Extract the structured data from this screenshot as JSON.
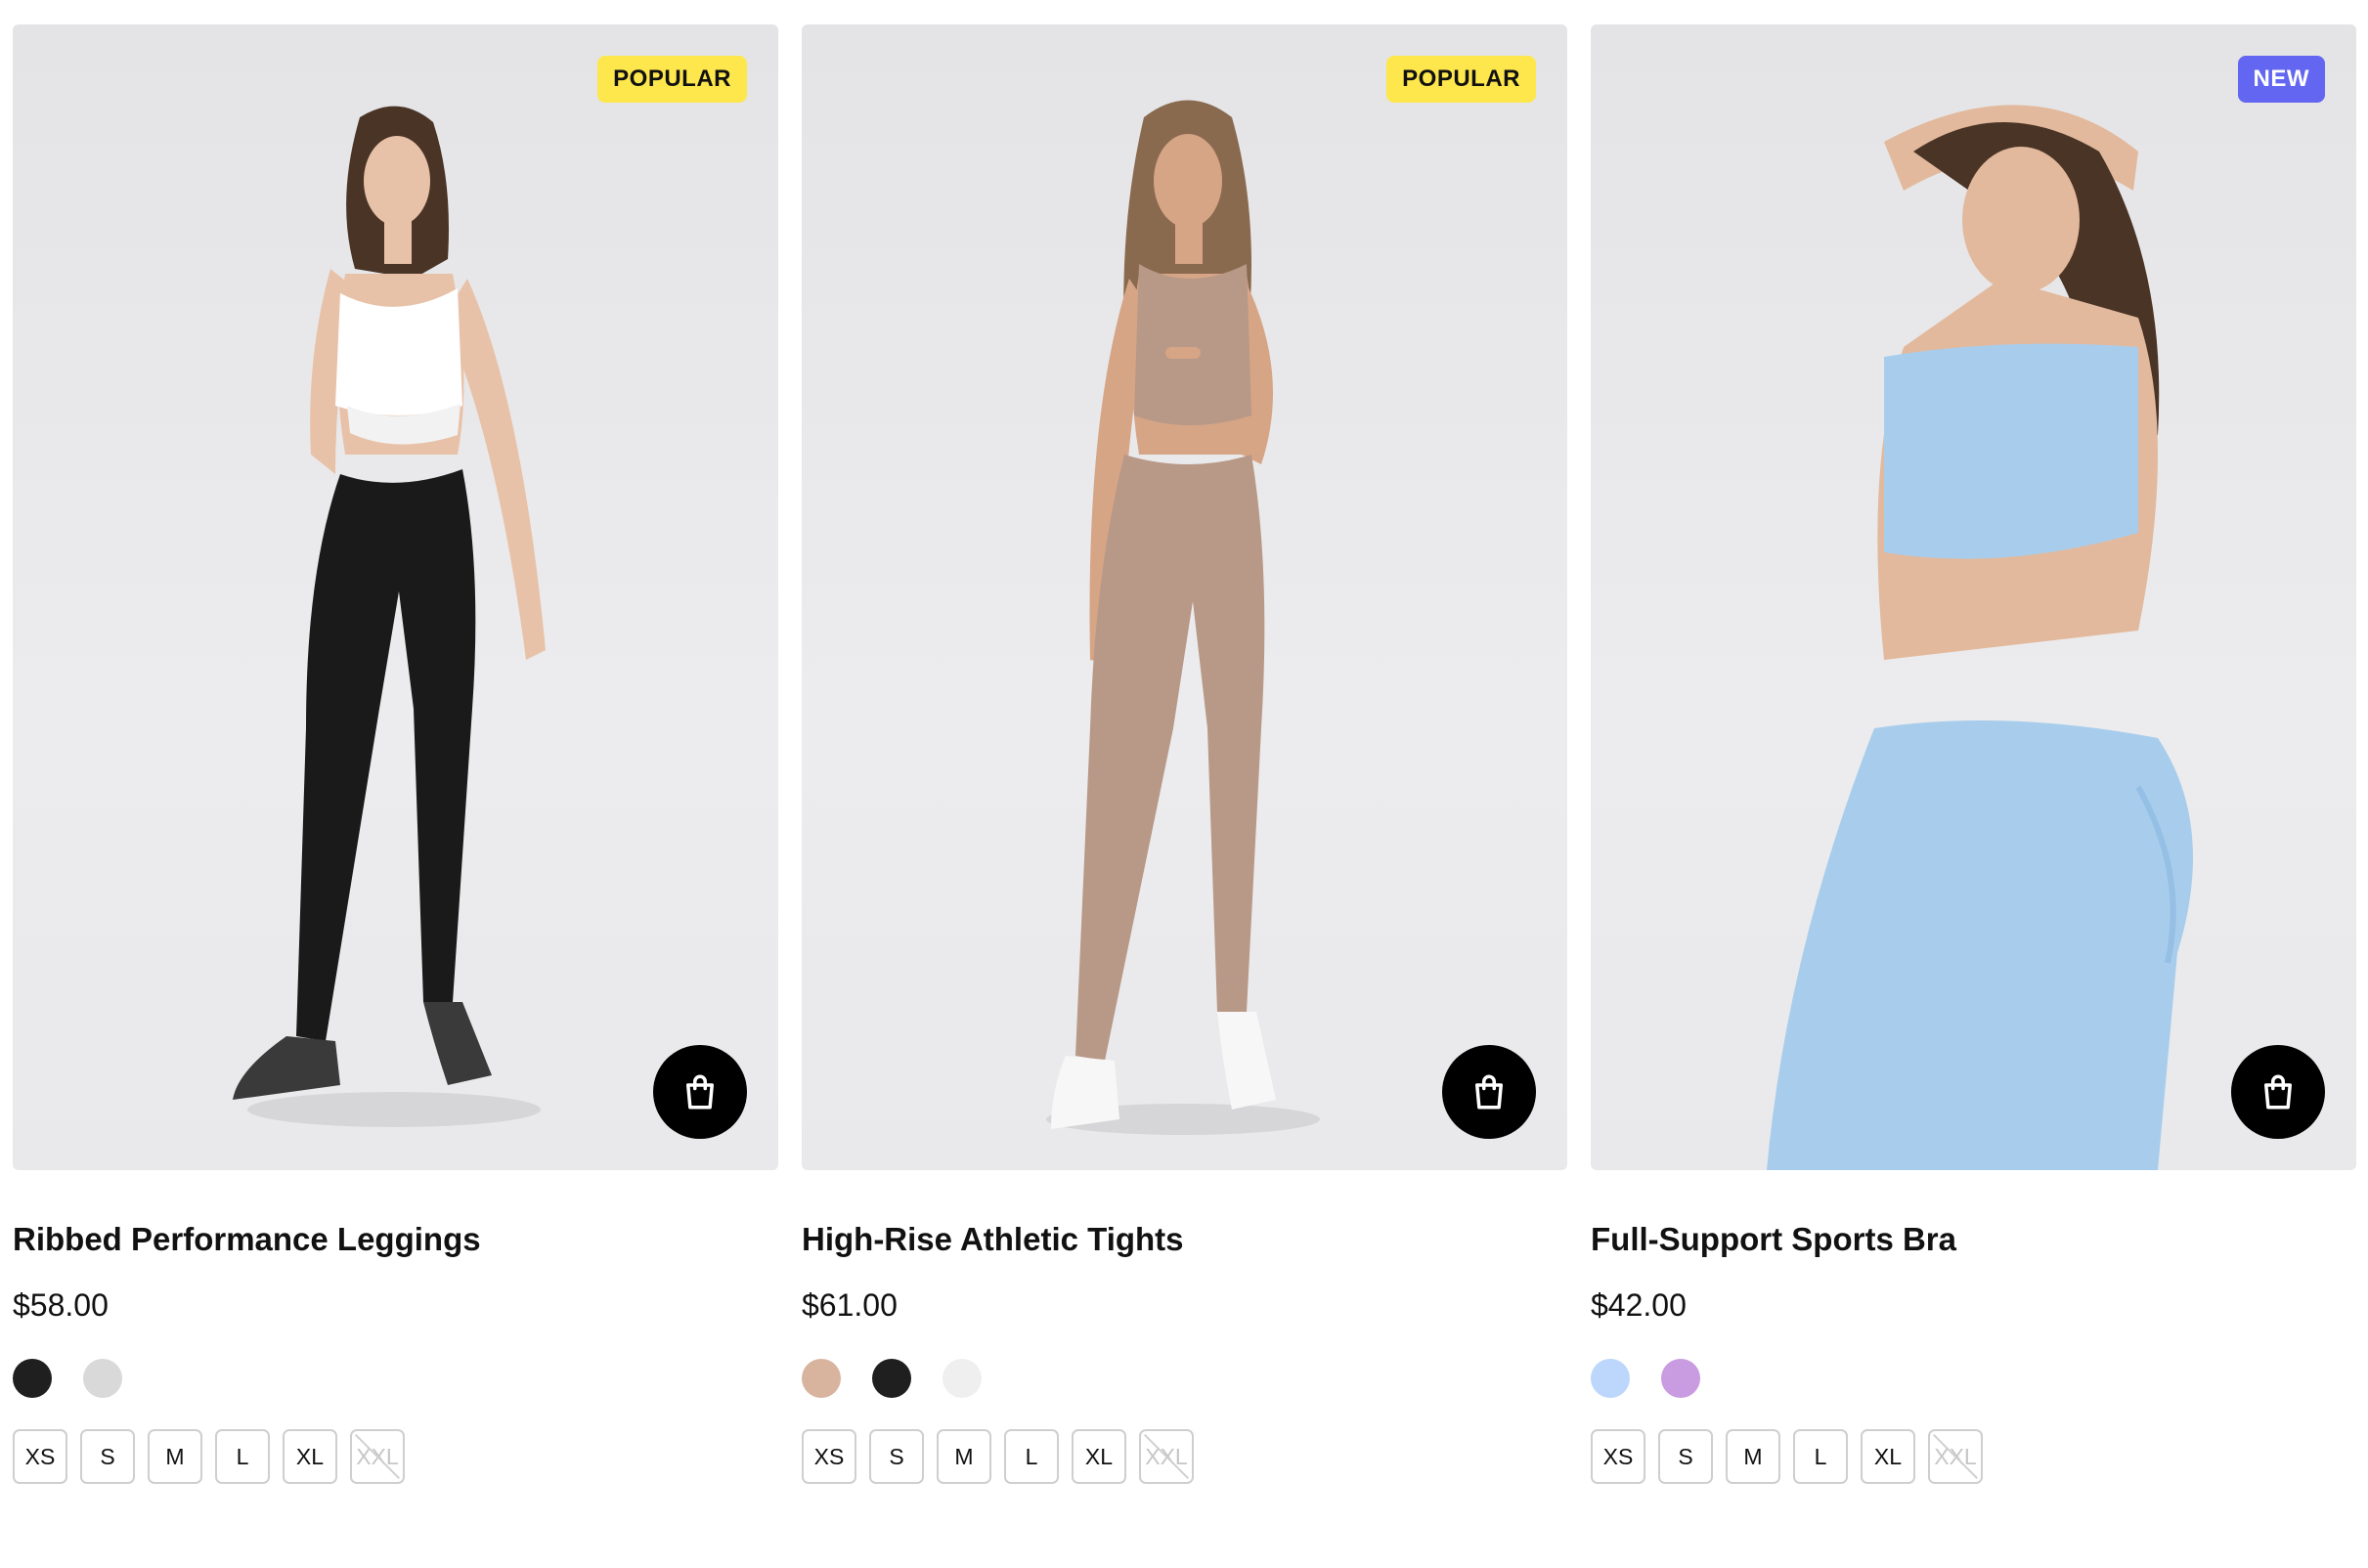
{
  "products": [
    {
      "badge": "POPULAR",
      "name": "Ribbed Performance Leggings",
      "price": "$58.00",
      "swatches": [
        "#1f1f1f",
        "#d9d9d9"
      ],
      "outfit": {
        "top": "#ffffff",
        "bottom": "#1a1a1a",
        "shoes": "#3a3a3a",
        "skin": "#e8c2a8",
        "hair": "#4a3426"
      },
      "sizes": [
        "XS",
        "S",
        "M",
        "L",
        "XL",
        "XXL"
      ],
      "unavailable": [
        "XXL"
      ]
    },
    {
      "badge": "POPULAR",
      "name": "High-Rise Athletic Tights",
      "price": "$61.00",
      "swatches": [
        "#d8b49f",
        "#1f1f1f",
        "#efefef"
      ],
      "outfit": {
        "top": "#b89886",
        "bottom": "#b89886",
        "shoes": "#f7f7f7",
        "skin": "#d6a586",
        "hair": "#8a6a4f"
      },
      "sizes": [
        "XS",
        "S",
        "M",
        "L",
        "XL",
        "XXL"
      ],
      "unavailable": [
        "XXL"
      ]
    },
    {
      "badge": "NEW",
      "name": "Full-Support Sports Bra",
      "price": "$42.00",
      "swatches": [
        "#bcd7fb",
        "#c99be0"
      ],
      "outfit": {
        "top": "#a8cdec",
        "bottom": "#a8cdec",
        "shoes": "#a8cdec",
        "skin": "#e2b99d",
        "hair": "#4a3426"
      },
      "sizes": [
        "XS",
        "S",
        "M",
        "L",
        "XL",
        "XXL"
      ],
      "unavailable": [
        "XXL"
      ]
    }
  ],
  "icons": {
    "cart": "shopping-bag-icon",
    "unavailable": "strike-through-icon"
  },
  "colors": {
    "popular_badge": "#fde74c",
    "new_badge": "#6366f1",
    "button": "#000000"
  }
}
